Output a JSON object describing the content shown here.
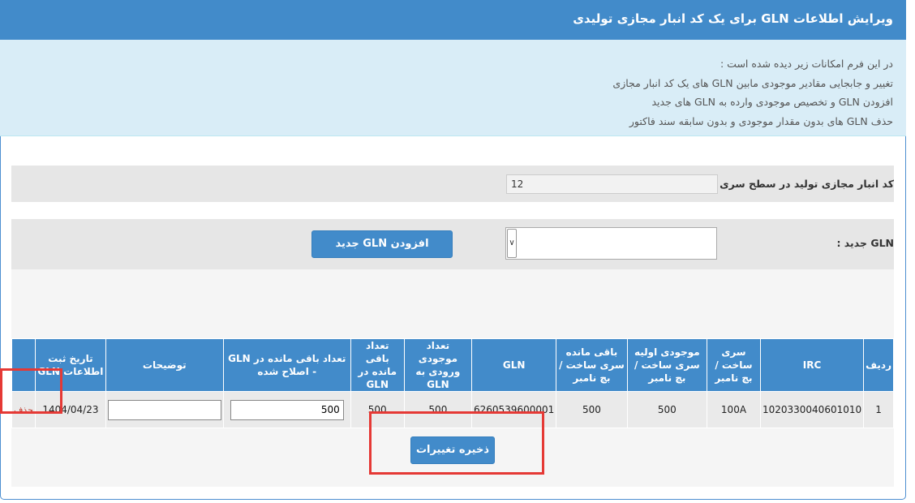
{
  "header": {
    "title": "ویرایش اطلاعات GLN برای یک کد انبار مجازی تولیدی"
  },
  "info": {
    "lines": [
      "در این فرم امکانات زیر دیده شده است :",
      "تغییر و جابجایی مقادیر موجودی مابین GLN های یک کد انبار مجازی",
      "افزودن GLN و تخصیص موجودی وارده به GLN های جدید",
      "حذف GLN های بدون مقدار موجودی و بدون سابقه سند فاکتور"
    ]
  },
  "warehouse": {
    "label": "کد انبار مجازی تولید در سطح سری ساخت :",
    "value": "12"
  },
  "new_gln": {
    "label": "GLN جدید :",
    "selected": "",
    "add_button": "افزودن GLN جدید"
  },
  "table": {
    "headers": {
      "row": "ردیف",
      "irc": "IRC",
      "batch": "سری ساخت / بچ نامبر",
      "initial": "موجودی اولیه سری ساخت / بچ نامبر",
      "remaining_batch": "باقی مانده سری ساخت / بچ نامبر",
      "gln": "GLN",
      "incoming": "تعداد موجودی ورودی به GLN",
      "remaining_gln": "تعداد باقی مانده در GLN",
      "edit": "تعداد باقی مانده در GLN - اصلاح شده",
      "desc": "توضیحات",
      "date": "تاریخ ثبت اطلاعات GLN"
    },
    "rows": [
      {
        "row": "1",
        "irc": "1020330040601010",
        "batch": "100A",
        "initial": "500",
        "remaining_batch": "500",
        "gln": "6260539600001",
        "incoming": "500",
        "remaining_gln": "500",
        "edit": "500",
        "desc": "",
        "date": "1404/04/23",
        "delete": "حذف"
      }
    ]
  },
  "save_button": "ذخیره تغییرات",
  "colors": {
    "primary": "#428bca",
    "info_bg": "#d9edf7",
    "highlight": "#e53935",
    "delete": "#c0392b"
  }
}
